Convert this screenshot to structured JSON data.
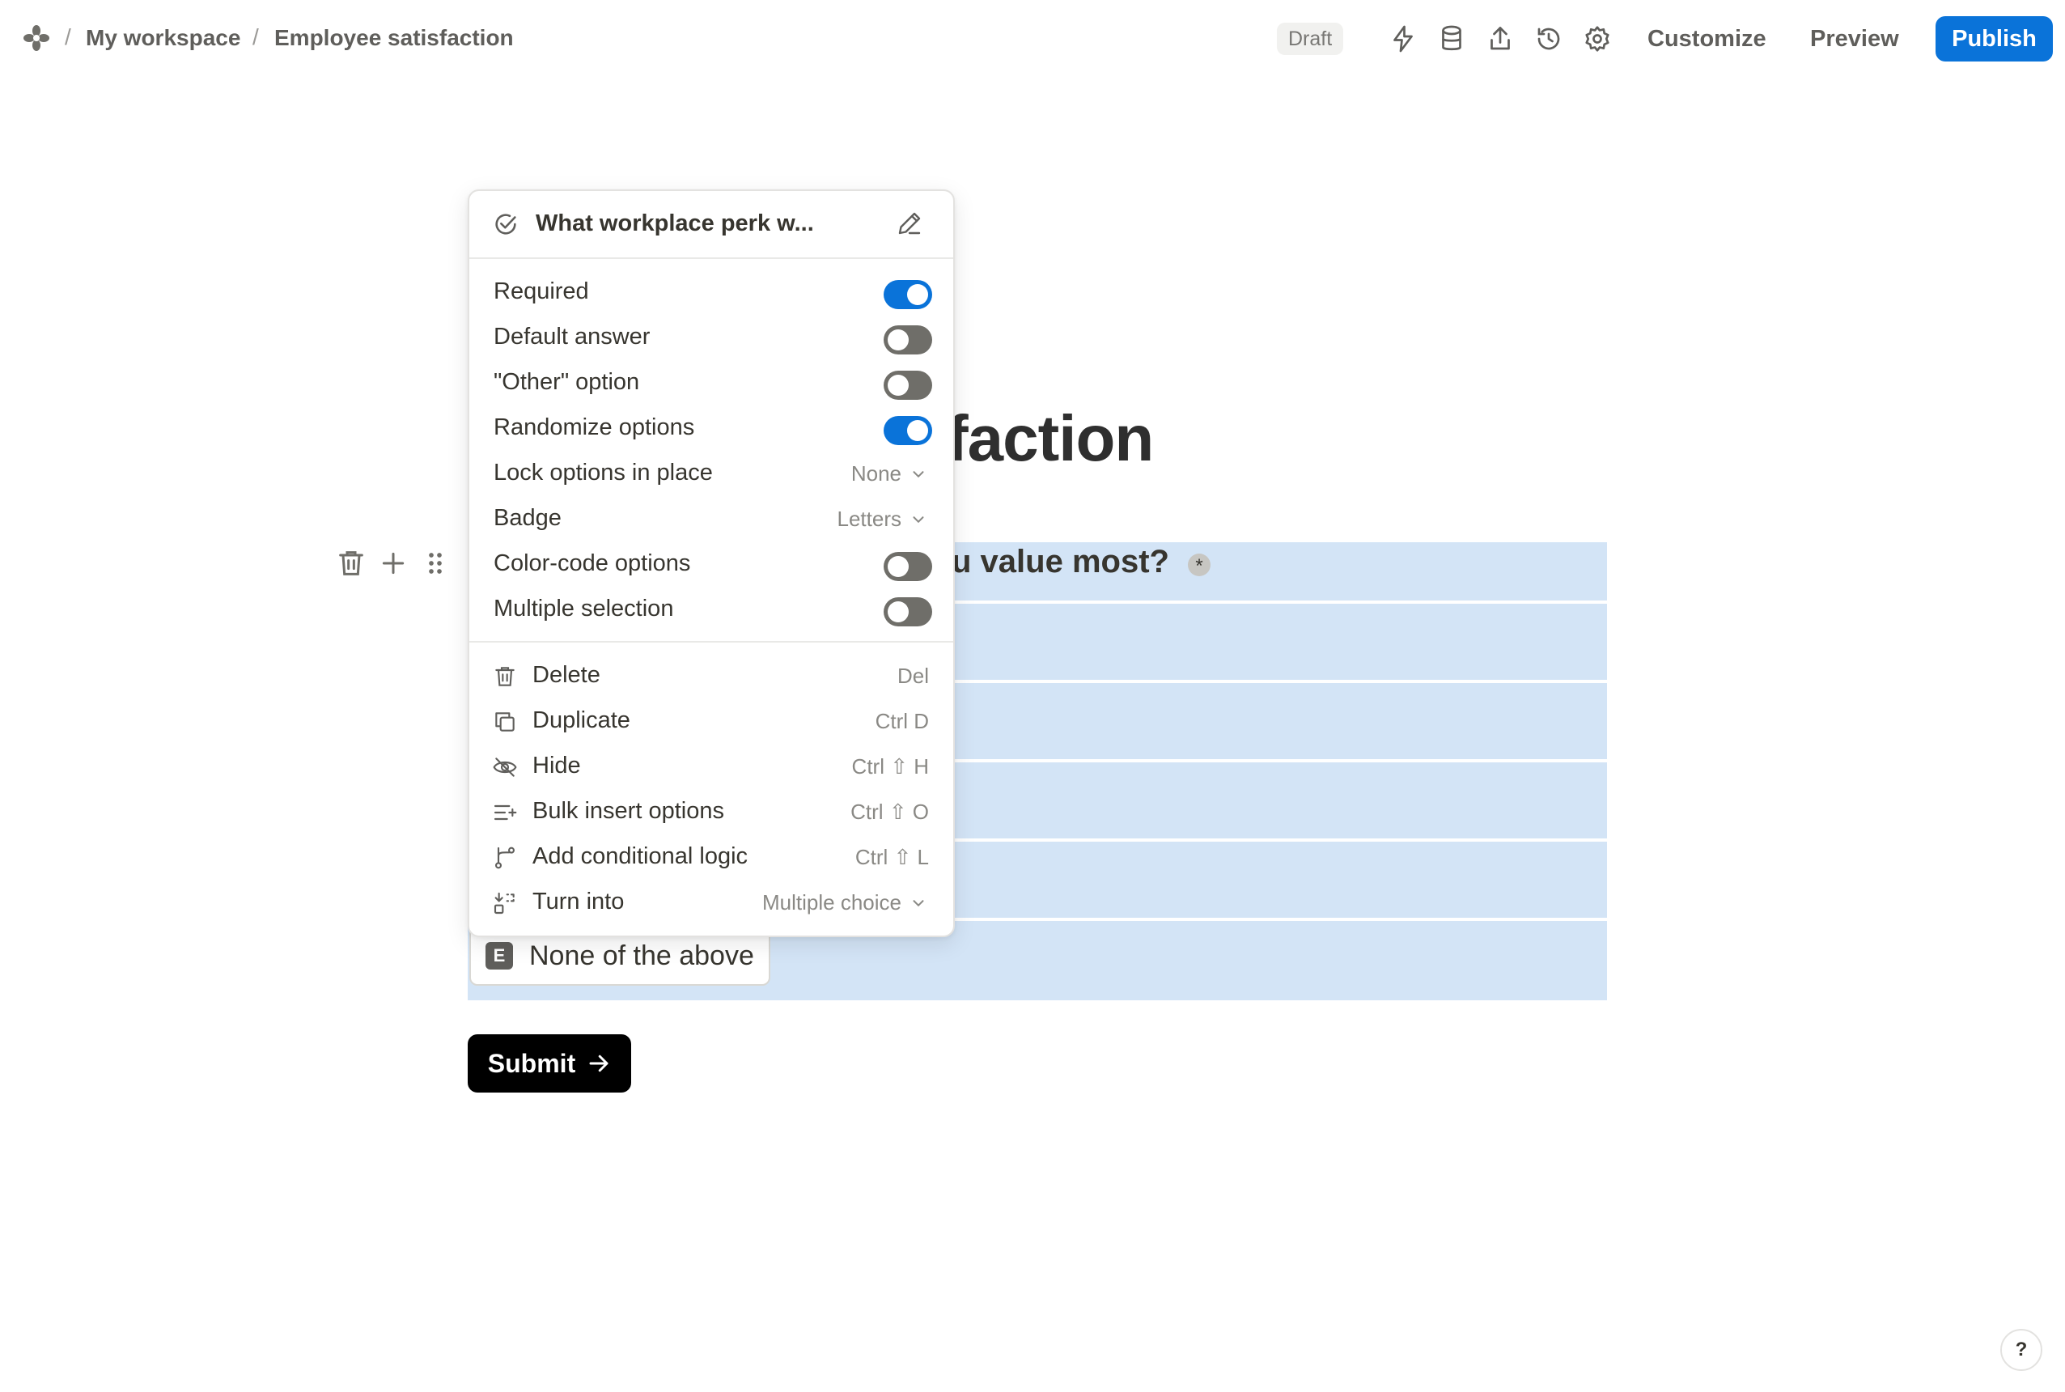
{
  "breadcrumb": {
    "separator": "/",
    "workspace": "My workspace",
    "page": "Employee satisfaction"
  },
  "header": {
    "status": "Draft",
    "icons": [
      "lightning-icon",
      "database-icon",
      "share-upload-icon",
      "history-icon",
      "settings-icon"
    ],
    "customize_label": "Customize",
    "preview_label": "Preview",
    "publish_label": "Publish"
  },
  "colors": {
    "accent": "#0a73d9",
    "selection": "#d3e4f6",
    "toggle_off": "#6f6e69"
  },
  "form": {
    "title_visible_fragment": "faction",
    "question_visible_fragment": "u value most?",
    "required_marker": "*",
    "visible_option": {
      "letter": "E",
      "text": "None of the above"
    },
    "submit_label": "Submit"
  },
  "menu": {
    "question_title": "What workplace perk w...",
    "settings": [
      {
        "label": "Required",
        "type": "toggle",
        "on": true
      },
      {
        "label": "Default answer",
        "type": "toggle",
        "on": false
      },
      {
        "label": "\"Other\" option",
        "type": "toggle",
        "on": false
      },
      {
        "label": "Randomize options",
        "type": "toggle",
        "on": true
      },
      {
        "label": "Lock options in place",
        "type": "dropdown",
        "value": "None"
      },
      {
        "label": "Badge",
        "type": "dropdown",
        "value": "Letters"
      },
      {
        "label": "Color-code options",
        "type": "toggle",
        "on": false
      },
      {
        "label": "Multiple selection",
        "type": "toggle",
        "on": false
      }
    ],
    "actions": [
      {
        "label": "Delete",
        "shortcut": "Del",
        "icon": "trash-icon"
      },
      {
        "label": "Duplicate",
        "shortcut": "Ctrl D",
        "icon": "duplicate-icon"
      },
      {
        "label": "Hide",
        "shortcut": "Ctrl ⇧ H",
        "icon": "eye-off-icon"
      },
      {
        "label": "Bulk insert options",
        "shortcut": "Ctrl ⇧ O",
        "icon": "bulk-insert-icon"
      },
      {
        "label": "Add conditional logic",
        "shortcut": "Ctrl ⇧ L",
        "icon": "branch-icon"
      },
      {
        "label": "Turn into",
        "value": "Multiple choice",
        "icon": "turn-into-icon"
      }
    ]
  },
  "help_label": "?"
}
